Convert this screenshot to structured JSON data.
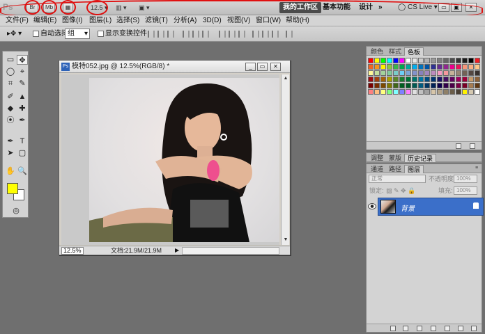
{
  "appbar": {
    "logo": "Ps",
    "br_label": "Br",
    "mb_label": "Mb",
    "zoom": "12.5",
    "workspaces": [
      "我的工作区",
      "基本功能",
      "设计"
    ],
    "more": "»",
    "cslive": "CS Live",
    "window_buttons": [
      "▭",
      "▣",
      "✕"
    ],
    "annotation_color": "#e01010"
  },
  "menubar": {
    "items": [
      "文件(F)",
      "编辑(E)",
      "图像(I)",
      "图层(L)",
      "选择(S)",
      "滤镜(T)",
      "分析(A)",
      "3D(D)",
      "视图(V)",
      "窗口(W)",
      "帮助(H)"
    ]
  },
  "options": {
    "auto_select_label": "自动选择:",
    "auto_select_value": "组",
    "transform_label": "显示变换控件"
  },
  "toolbox": {
    "tools": [
      "▭",
      "✥",
      "◯",
      "⌖",
      "⌗",
      "✎",
      "✐",
      "▲",
      "◆",
      "✚",
      "⦿",
      "✒",
      "T",
      "➤",
      "▢",
      "✋",
      "🔍"
    ],
    "fg_color": "#ffff00",
    "bg_color": "#ffffff",
    "quick_mask": "◎"
  },
  "document": {
    "icon_label": "Ps",
    "title": "模特052.jpg @ 12.5%(RGB/8) *",
    "buttons": [
      "_",
      "▭",
      "✕"
    ],
    "zoom": "12.5%",
    "status": "文档:21.9M/21.9M"
  },
  "color_panel": {
    "tabs": [
      "颜色",
      "样式",
      "色板"
    ],
    "active_tab": 2
  },
  "history_panel": {
    "tabs": [
      "调整",
      "蒙版",
      "历史记录"
    ],
    "active_tab": 2
  },
  "layers_panel": {
    "tabs": [
      "通道",
      "路径",
      "图层"
    ],
    "active_tab": 2,
    "blend_mode": "正常",
    "opacity_label": "不透明度:",
    "opacity_value": "100%",
    "lock_label": "锁定:",
    "fill_label": "填充:",
    "fill_value": "100%",
    "layers": [
      {
        "name": "背景",
        "selected": true,
        "locked": true
      }
    ],
    "footer_icons": [
      "link-icon",
      "fx-icon",
      "mask-icon",
      "adjustment-icon",
      "group-icon",
      "new-layer-icon",
      "trash-icon"
    ]
  }
}
